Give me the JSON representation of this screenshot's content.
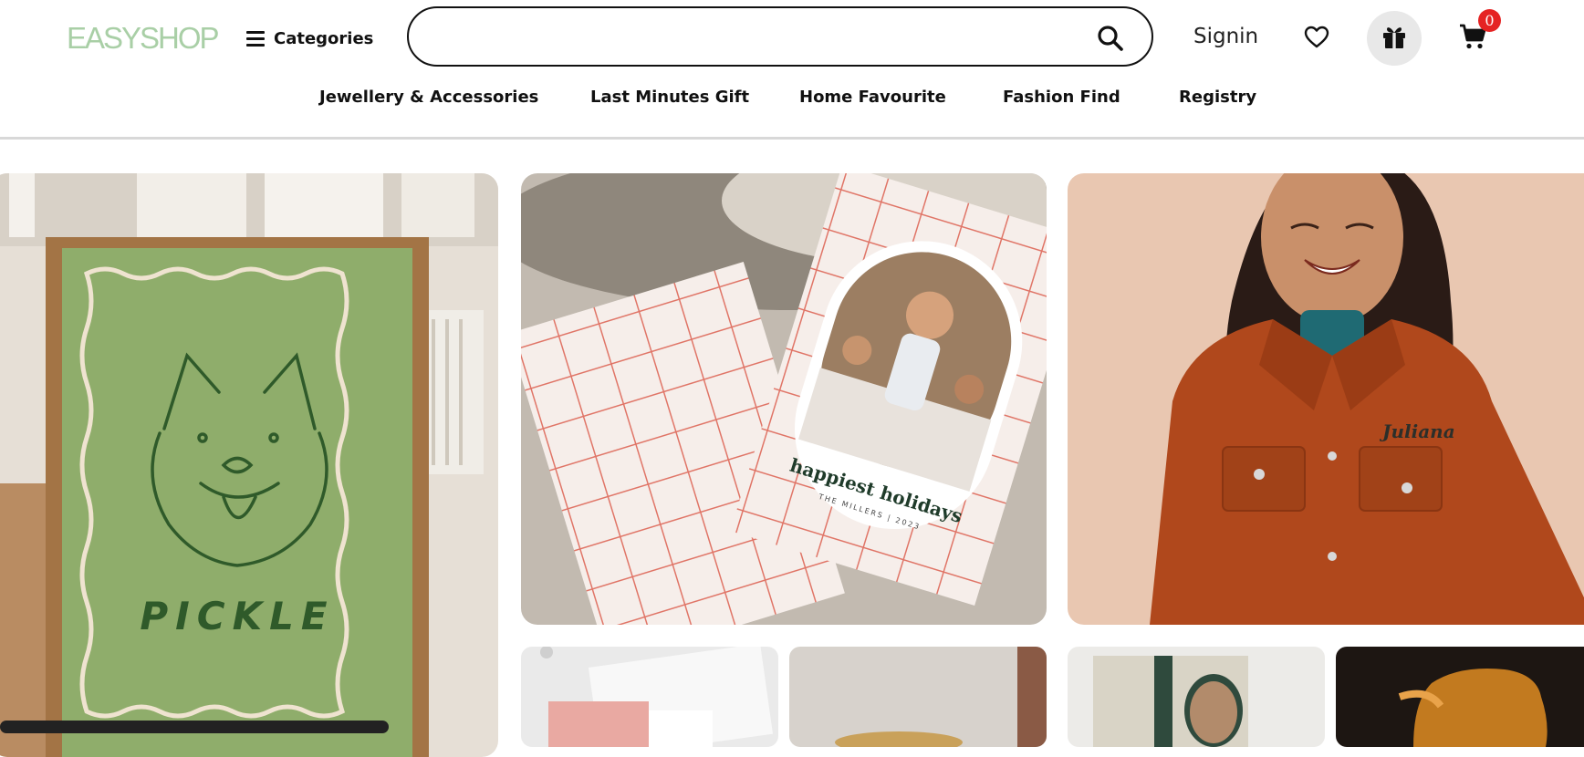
{
  "header": {
    "logo": "EASYSHOP",
    "categories_label": "Categories",
    "search": {
      "value": "",
      "placeholder": ""
    },
    "signin_label": "Signin",
    "cart_count": "0",
    "icons": [
      "menu-icon",
      "search-icon",
      "heart-icon",
      "gift-icon",
      "cart-icon"
    ]
  },
  "nav": [
    "Jewellery & Accessories",
    "Last Minutes Gift",
    "Home Favourite",
    "Fashion Find",
    "Registry"
  ],
  "tiles": {
    "poster_text": "PICKLE",
    "card_text": "happiest holidays",
    "card_subtext": "THE MILLERS | 2023",
    "jacket_text": "Juliana"
  },
  "colors": {
    "logo": "#a9cfa6",
    "badge": "#e52323",
    "poster_green": "#8fad6b",
    "card_grid_red": "#e07567",
    "jacket_rust": "#b0481c"
  }
}
